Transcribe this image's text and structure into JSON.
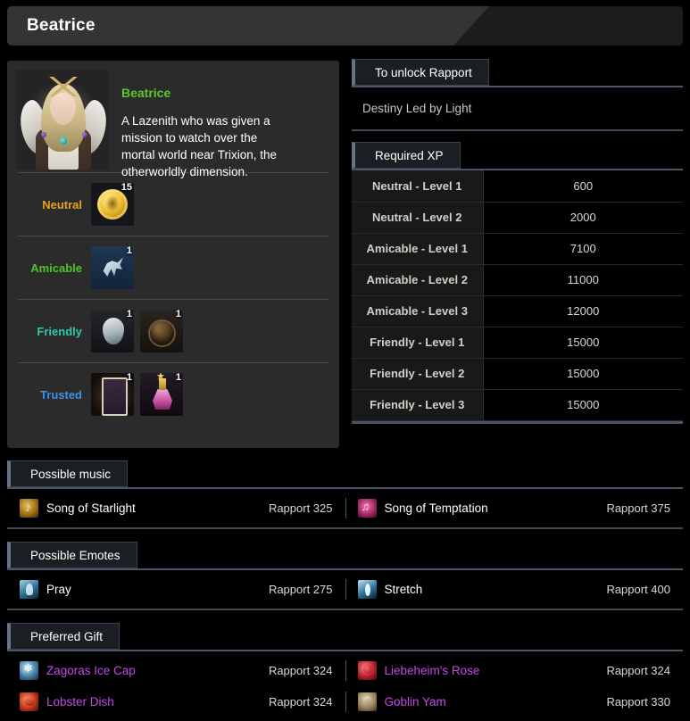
{
  "window": {
    "title": "Beatrice"
  },
  "character": {
    "name": "Beatrice",
    "description": "A Lazenith who was given a mission to watch over the mortal world near Trixion, the otherworldly dimension.",
    "tiers": [
      {
        "label": "Neutral",
        "color": "#e8a21c",
        "items": [
          {
            "icon": "gold-coin-icon",
            "qty": "15"
          }
        ]
      },
      {
        "label": "Amicable",
        "color": "#4fc52a",
        "items": [
          {
            "icon": "mount-card-icon",
            "qty": "1"
          }
        ]
      },
      {
        "label": "Friendly",
        "color": "#2fc9a4",
        "items": [
          {
            "icon": "heart-icon",
            "qty": "1"
          },
          {
            "icon": "potion-jug-icon",
            "qty": "1"
          }
        ]
      },
      {
        "label": "Trusted",
        "color": "#3d8fe8",
        "items": [
          {
            "icon": "tarot-card-icon",
            "qty": "1"
          },
          {
            "icon": "pink-flask-icon",
            "qty": "1"
          }
        ]
      }
    ]
  },
  "unlock": {
    "header": "To unlock Rapport",
    "quest": "Destiny Led by Light"
  },
  "required_xp": {
    "header": "Required XP",
    "rows": [
      {
        "level": "Neutral - Level 1",
        "xp": "600"
      },
      {
        "level": "Neutral - Level 2",
        "xp": "2000"
      },
      {
        "level": "Amicable - Level 1",
        "xp": "7100"
      },
      {
        "level": "Amicable - Level 2",
        "xp": "11000"
      },
      {
        "level": "Amicable - Level 3",
        "xp": "12000"
      },
      {
        "level": "Friendly - Level 1",
        "xp": "15000"
      },
      {
        "level": "Friendly - Level 2",
        "xp": "15000"
      },
      {
        "level": "Friendly - Level 3",
        "xp": "15000"
      }
    ]
  },
  "music": {
    "header": "Possible music",
    "rows": [
      [
        {
          "icon": "song-of-starlight-icon",
          "name": "Song of Starlight",
          "rapport": "Rapport 325"
        },
        {
          "icon": "song-of-temptation-icon",
          "name": "Song of Temptation",
          "rapport": "Rapport 375"
        }
      ]
    ]
  },
  "emotes": {
    "header": "Possible Emotes",
    "rows": [
      [
        {
          "icon": "pray-emote-icon",
          "name": "Pray",
          "rapport": "Rapport 275"
        },
        {
          "icon": "stretch-emote-icon",
          "name": "Stretch",
          "rapport": "Rapport 400"
        }
      ]
    ]
  },
  "gifts": {
    "header": "Preferred Gift",
    "rows": [
      [
        {
          "icon": "zagoras-ice-cap-icon",
          "name": "Zagoras Ice Cap",
          "rapport": "Rapport 324"
        },
        {
          "icon": "liebeheims-rose-icon",
          "name": "Liebeheim's Rose",
          "rapport": "Rapport 324"
        }
      ],
      [
        {
          "icon": "lobster-dish-icon",
          "name": "Lobster Dish",
          "rapport": "Rapport 324"
        },
        {
          "icon": "goblin-yam-icon",
          "name": "Goblin Yam",
          "rapport": "Rapport 330"
        }
      ]
    ]
  },
  "colors": {
    "accent_bar": "#66748a",
    "underline": "#4a5666",
    "character_name": "#5cc631",
    "gift_name": "#c448e8"
  }
}
